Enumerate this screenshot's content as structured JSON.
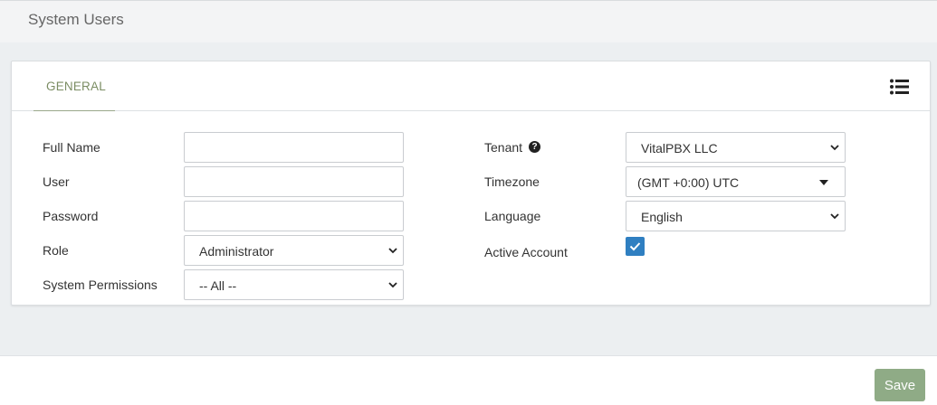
{
  "header": {
    "title": "System Users"
  },
  "tabs": [
    {
      "label": "GENERAL",
      "active": true
    }
  ],
  "toolbar": {
    "list_icon": "list-icon"
  },
  "form": {
    "full_name": {
      "label": "Full Name",
      "value": ""
    },
    "user": {
      "label": "User",
      "value": ""
    },
    "password": {
      "label": "Password",
      "value": ""
    },
    "role": {
      "label": "Role",
      "value": "Administrator"
    },
    "system_permissions": {
      "label": "System Permissions",
      "value": "-- All --"
    },
    "tenant": {
      "label": "Tenant",
      "value": "VitalPBX LLC",
      "help_icon": "question-circle-icon"
    },
    "timezone": {
      "label": "Timezone",
      "value": "(GMT +0:00) UTC"
    },
    "language": {
      "label": "Language",
      "value": "English"
    },
    "active_account": {
      "label": "Active Account",
      "checked": true
    }
  },
  "footer": {
    "save_label": "Save"
  },
  "colors": {
    "accent": "#7b8d63",
    "save_button": "#8fab86",
    "checkbox": "#2f7fc1"
  }
}
